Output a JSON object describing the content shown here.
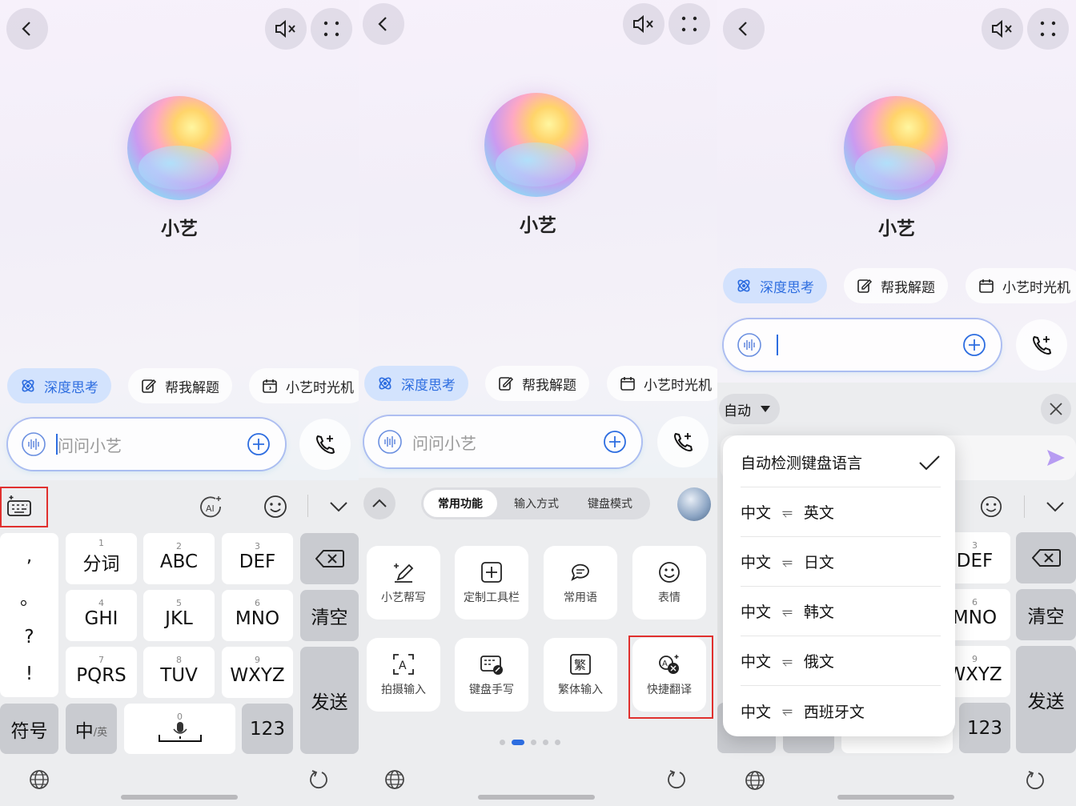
{
  "assistant": {
    "name": "小艺"
  },
  "chips": {
    "deep_think": "深度思考",
    "solve": "帮我解题",
    "time_machine": "小艺时光机"
  },
  "input": {
    "placeholder": "问问小艺"
  },
  "keyboard": {
    "punct": [
      ",",
      "。",
      "?",
      "!"
    ],
    "keys": [
      {
        "num": "1",
        "label": "分词"
      },
      {
        "num": "2",
        "label": "ABC"
      },
      {
        "num": "3",
        "label": "DEF"
      },
      {
        "num": "4",
        "label": "GHI"
      },
      {
        "num": "5",
        "label": "JKL"
      },
      {
        "num": "6",
        "label": "MNO"
      },
      {
        "num": "7",
        "label": "PQRS"
      },
      {
        "num": "8",
        "label": "TUV"
      },
      {
        "num": "9",
        "label": "WXYZ"
      }
    ],
    "clear": "清空",
    "send": "发送",
    "symbol": "符号",
    "zh": "中",
    "en": "/英",
    "space_num": "0",
    "num_key": "123"
  },
  "panel2": {
    "tabs": [
      "常用功能",
      "输入方式",
      "键盘模式"
    ],
    "tiles": [
      "小艺帮写",
      "定制工具栏",
      "常用语",
      "表情",
      "拍摄输入",
      "键盘手写",
      "繁体输入",
      "快捷翻译"
    ]
  },
  "panel3": {
    "lang_select": "自动",
    "menu": {
      "auto_detect": "自动检测键盘语言",
      "source": "中文",
      "targets": [
        "英文",
        "日文",
        "韩文",
        "俄文",
        "西班牙文"
      ]
    },
    "visible_keys": [
      "DEF",
      "MNO",
      "WXYZ"
    ],
    "visible_nums": [
      "3",
      "6",
      "9"
    ]
  },
  "colors": {
    "accent": "#2d6de0",
    "highlight": "#e0302e",
    "send_arrow": "#b79cf2"
  }
}
